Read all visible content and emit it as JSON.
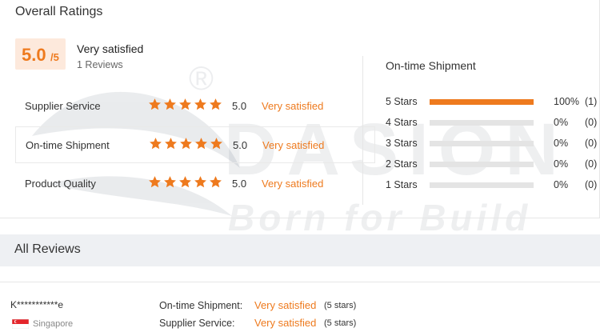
{
  "overall": {
    "title": "Overall Ratings",
    "score": "5.0",
    "score_max": "/5",
    "summary": "Very satisfied",
    "review_count": "1 Reviews"
  },
  "ratings": [
    {
      "label": "Supplier Service",
      "value": "5.0",
      "text": "Very satisfied",
      "stars": 5
    },
    {
      "label": "On-time Shipment",
      "value": "5.0",
      "text": "Very satisfied",
      "stars": 5
    },
    {
      "label": "Product Quality",
      "value": "5.0",
      "text": "Very satisfied",
      "stars": 5
    }
  ],
  "shipment": {
    "title": "On-time Shipment",
    "rows": [
      {
        "label": "5  Stars",
        "percent": "100%",
        "count": "(1)",
        "fill": 1.0
      },
      {
        "label": "4  Stars",
        "percent": "0%",
        "count": "(0)",
        "fill": 0
      },
      {
        "label": "3  Stars",
        "percent": "0%",
        "count": "(0)",
        "fill": 0
      },
      {
        "label": "2  Stars",
        "percent": "0%",
        "count": "(0)",
        "fill": 0
      },
      {
        "label": "1  Stars",
        "percent": "0%",
        "count": "(0)",
        "fill": 0
      }
    ]
  },
  "reviews": {
    "title": "All Reviews",
    "items": [
      {
        "reviewer": "K***********e",
        "country": "Singapore",
        "ratings": [
          {
            "label": "On-time Shipment:",
            "value": "Very satisfied",
            "note": "(5 stars)"
          },
          {
            "label": "Supplier Service:",
            "value": "Very satisfied",
            "note": "(5 stars)"
          }
        ]
      }
    ]
  },
  "watermark": {
    "mark": "®",
    "brand": "DASION",
    "tagline": "Born for Build"
  },
  "colors": {
    "accent": "#ee7a1e",
    "score_bg": "#fde9dc",
    "bar_track": "#e4e4e4",
    "section_bar": "#eef0f3"
  }
}
